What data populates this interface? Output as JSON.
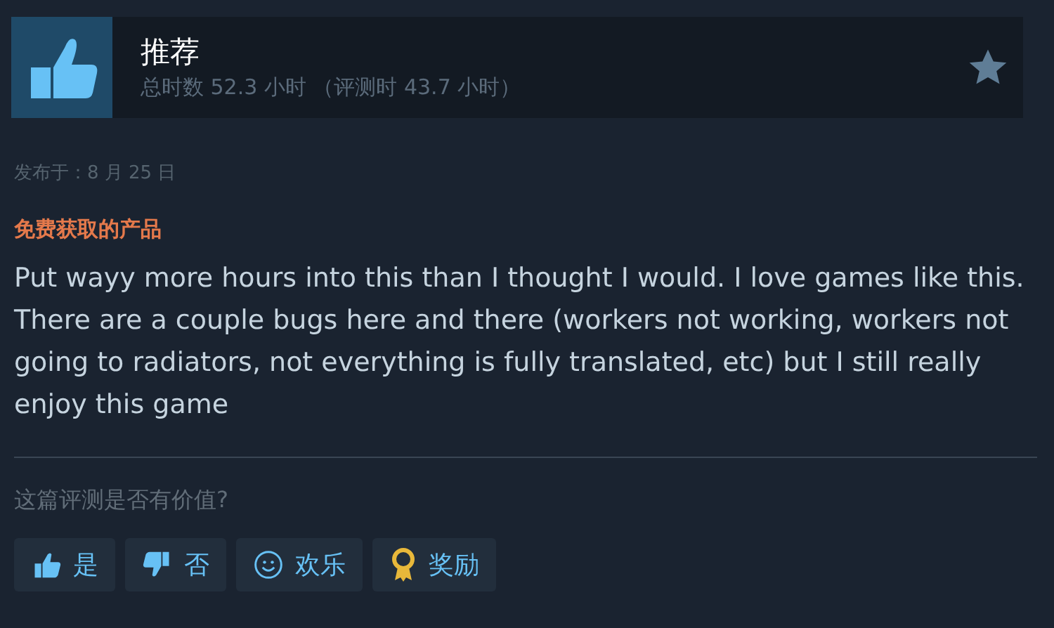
{
  "review": {
    "verdict": "推荐",
    "recommended": true,
    "hours": "总时数 52.3 小时 （评测时 43.7 小时）",
    "posted": "发布于：8 月 25 日",
    "tag": "免费获取的产品",
    "text": "Put wayy more hours into this than I thought I would. I love games like this. There are a couple bugs here and there (workers not working, workers not going to radiators, not everything is fully translated, etc) but I still really enjoy this game"
  },
  "helpful": {
    "question": "这篇评测是否有价值?",
    "buttons": [
      {
        "kind": "yes",
        "label": "是"
      },
      {
        "kind": "no",
        "label": "否"
      },
      {
        "kind": "funny",
        "label": "欢乐"
      },
      {
        "kind": "award",
        "label": "奖励"
      }
    ]
  }
}
